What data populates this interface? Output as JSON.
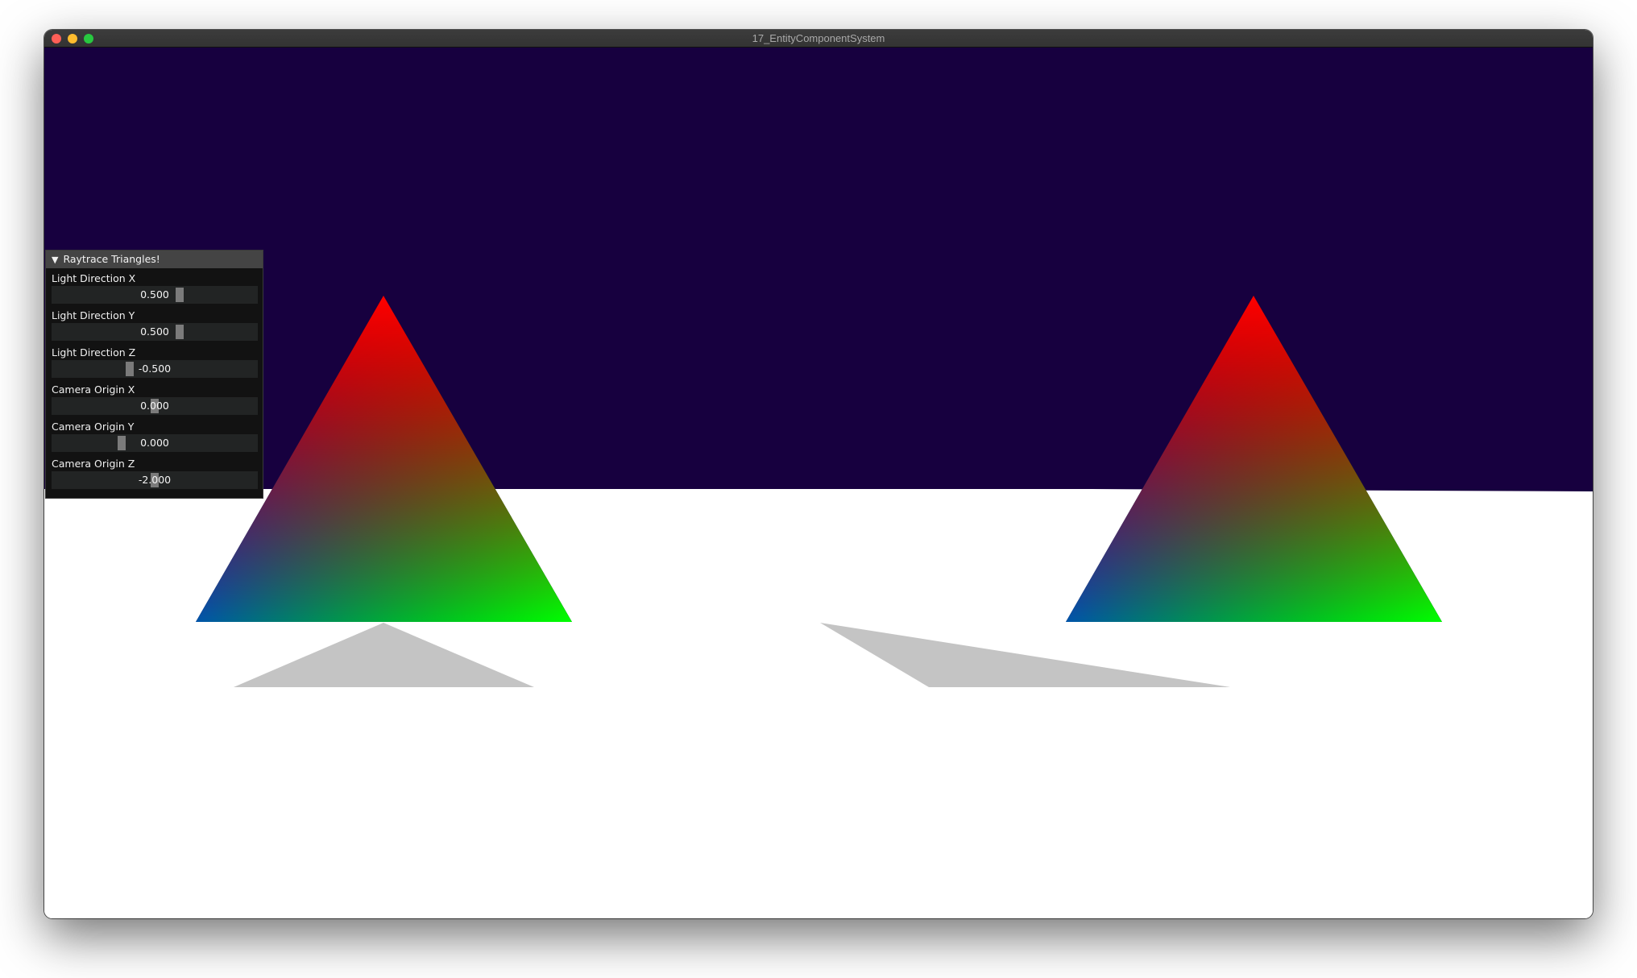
{
  "window": {
    "title": "17_EntityComponentSystem",
    "buttons": [
      "close",
      "minimize",
      "maximize"
    ]
  },
  "scene": {
    "sky_color": "#17003f",
    "ground_color": "#ffffff",
    "shadow_color": "#c4c4c4",
    "triangle_vertex_colors": {
      "top": "#ff0000",
      "bottom_left": "#0000ff",
      "bottom_right": "#00ff00"
    },
    "objects": [
      {
        "name": "left-triangle",
        "type": "rgb-gradient-triangle"
      },
      {
        "name": "left-triangle-shadow",
        "type": "shadow"
      },
      {
        "name": "right-triangle",
        "type": "rgb-gradient-triangle"
      },
      {
        "name": "right-triangle-shadow",
        "type": "shadow"
      }
    ]
  },
  "panel": {
    "title": "Raytrace Triangles!",
    "collapse_icon": "triangle-down",
    "sliders": [
      {
        "label": "Light Direction X",
        "value": "0.500",
        "fraction": 0.62
      },
      {
        "label": "Light Direction Y",
        "value": "0.500",
        "fraction": 0.62
      },
      {
        "label": "Light Direction Z",
        "value": "-0.500",
        "fraction": 0.38
      },
      {
        "label": "Camera Origin X",
        "value": "0.000",
        "fraction": 0.5
      },
      {
        "label": "Camera Origin Y",
        "value": "0.000",
        "fraction": 0.34
      },
      {
        "label": "Camera Origin Z",
        "value": "-2.000",
        "fraction": 0.5
      }
    ]
  }
}
